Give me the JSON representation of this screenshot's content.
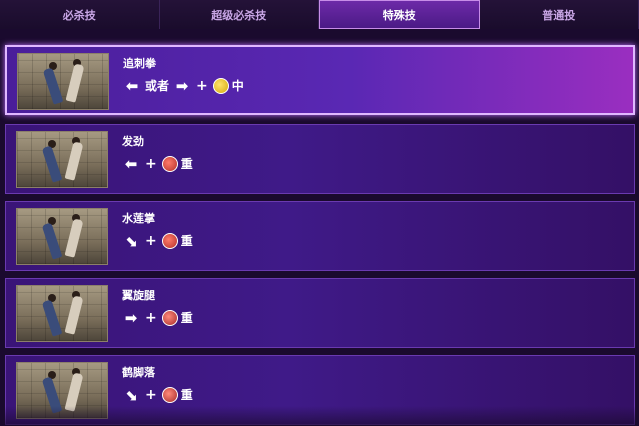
{
  "tabs": [
    {
      "label": "必杀技"
    },
    {
      "label": "超级必杀技"
    },
    {
      "label": "特殊技"
    },
    {
      "label": "普通投"
    }
  ],
  "moves": [
    {
      "name": "追刺拳",
      "or_text": "或者",
      "strength": "中"
    },
    {
      "name": "发劲",
      "strength": "重"
    },
    {
      "name": "水莲掌",
      "strength": "重"
    },
    {
      "name": "翼旋腿",
      "strength": "重"
    },
    {
      "name": "鹤脚落",
      "strength": "重"
    }
  ],
  "glyphs": {
    "plus": "+",
    "left": "⬅",
    "right": "➡",
    "down_right": "⬊"
  },
  "colors": {
    "accent": "#e0b8ff",
    "active_tab": "#6d2aa8"
  }
}
